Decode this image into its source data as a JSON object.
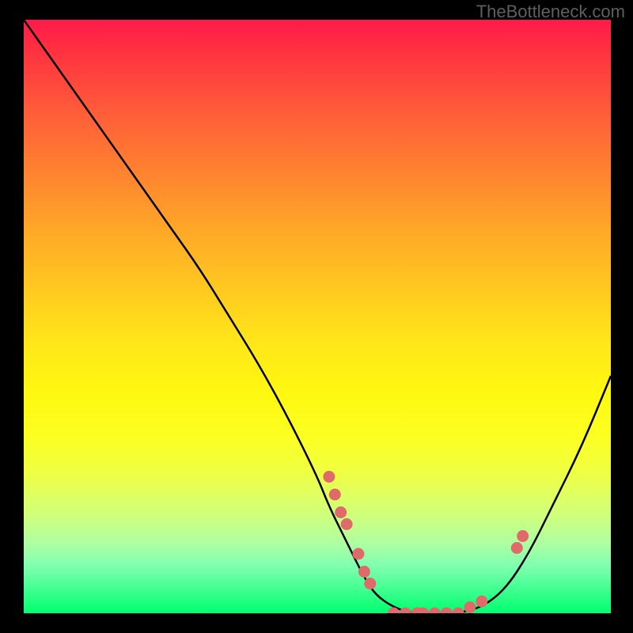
{
  "watermark": "TheBottleneck.com",
  "chart_data": {
    "type": "line",
    "title": "",
    "xlabel": "",
    "ylabel": "",
    "xlim": [
      0,
      100
    ],
    "ylim": [
      0,
      100
    ],
    "gradient_colors": {
      "top": "#ff1a4a",
      "mid_upper": "#ffa628",
      "mid": "#fff810",
      "mid_lower": "#ccff80",
      "bottom": "#00ff70"
    },
    "curve": {
      "description": "V-shaped bottleneck curve descending steeply from top-left, flattening at bottom around x≈60-75, then rising toward right",
      "x": [
        0,
        5,
        10,
        15,
        20,
        25,
        30,
        35,
        40,
        45,
        50,
        52,
        55,
        58,
        60,
        63,
        66,
        70,
        74,
        78,
        82,
        86,
        90,
        95,
        100
      ],
      "y": [
        100,
        93,
        86,
        79,
        72,
        65,
        58,
        50,
        42,
        33,
        23,
        18,
        12,
        6,
        3,
        1,
        0,
        0,
        0,
        1,
        4,
        10,
        18,
        28,
        40
      ]
    },
    "markers": {
      "color": "#e06a6a",
      "points": [
        {
          "x": 52,
          "y": 23
        },
        {
          "x": 53,
          "y": 20
        },
        {
          "x": 54,
          "y": 17
        },
        {
          "x": 55,
          "y": 15
        },
        {
          "x": 57,
          "y": 10
        },
        {
          "x": 58,
          "y": 7
        },
        {
          "x": 59,
          "y": 5
        },
        {
          "x": 63,
          "y": 0
        },
        {
          "x": 65,
          "y": 0
        },
        {
          "x": 67,
          "y": 0
        },
        {
          "x": 68,
          "y": 0
        },
        {
          "x": 70,
          "y": 0
        },
        {
          "x": 72,
          "y": 0
        },
        {
          "x": 74,
          "y": 0
        },
        {
          "x": 76,
          "y": 1
        },
        {
          "x": 78,
          "y": 2
        },
        {
          "x": 84,
          "y": 11
        },
        {
          "x": 85,
          "y": 13
        }
      ]
    }
  }
}
